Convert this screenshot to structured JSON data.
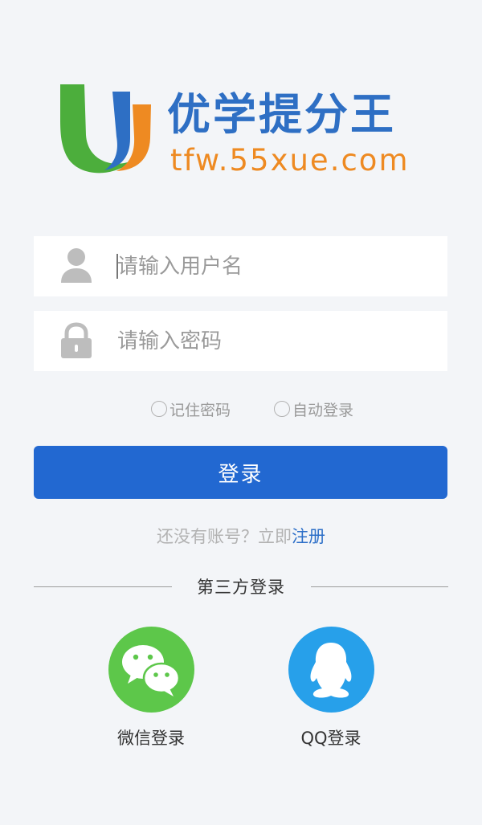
{
  "brand": {
    "name": "优学提分王",
    "url": "tfw.55xue.com"
  },
  "form": {
    "username_placeholder": "请输入用户名",
    "password_placeholder": "请输入密码",
    "remember_label": "记住密码",
    "auto_login_label": "自动登录",
    "login_label": "登录"
  },
  "register": {
    "prompt": "还没有账号？立即",
    "link": "注册"
  },
  "third_party": {
    "title": "第三方登录",
    "wechat_label": "微信登录",
    "qq_label": "QQ登录"
  },
  "colors": {
    "primary": "#2268d1",
    "brand_blue": "#2e6fc4",
    "brand_orange": "#ee8a22",
    "brand_green": "#4cae3c",
    "wechat_green": "#5dc74a",
    "qq_blue": "#27a0ea",
    "background": "#f3f5f8"
  },
  "icons": {
    "username": "user-icon",
    "password": "lock-icon",
    "wechat": "wechat-icon",
    "qq": "qq-icon"
  }
}
